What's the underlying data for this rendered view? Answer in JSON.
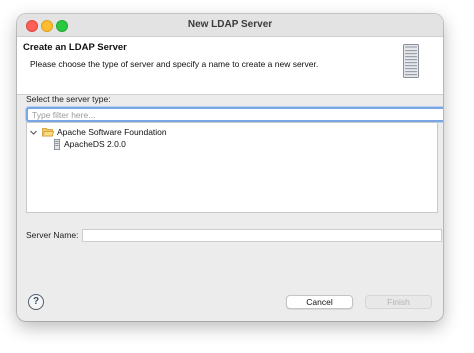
{
  "window": {
    "title": "New LDAP Server"
  },
  "banner": {
    "title": "Create an LDAP Server",
    "description": "Please choose the type of server and specify a name to create a new server."
  },
  "server_type": {
    "label": "Select the server type:",
    "filter_placeholder": "Type filter here...",
    "filter_value": ""
  },
  "tree": {
    "items": [
      {
        "label": "Apache Software Foundation",
        "icon": "folder-open-icon",
        "expanded": true
      },
      {
        "label": "ApacheDS 2.0.0",
        "icon": "server-icon"
      }
    ]
  },
  "server_name": {
    "label": "Server Name:",
    "value": ""
  },
  "buttons": {
    "help_glyph": "?",
    "cancel_label": "Cancel",
    "finish_label": "Finish"
  },
  "colors": {
    "close": "#fe5f57",
    "minimize": "#febc2e",
    "maximize": "#28c840",
    "focus_ring": "#7aa6e6"
  }
}
